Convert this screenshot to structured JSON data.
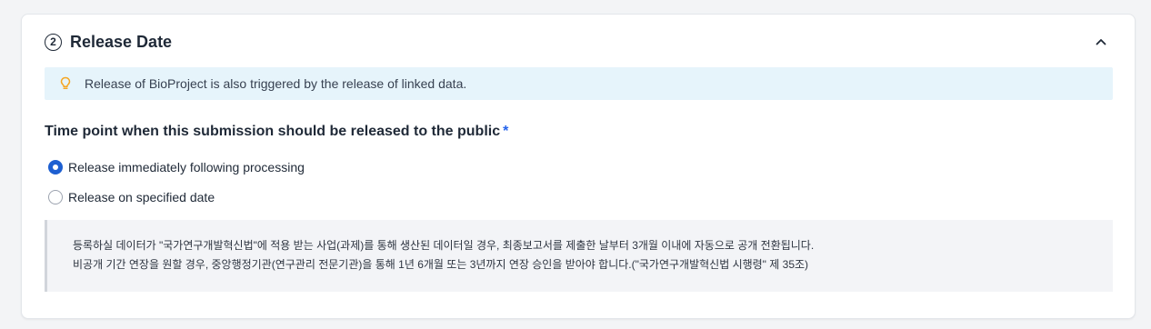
{
  "section": {
    "step_number": "2",
    "title": "Release Date",
    "collapse_icon": "chevron-up-icon"
  },
  "info": {
    "icon": "lightbulb-icon",
    "text": "Release of BioProject is also triggered by the release of linked data."
  },
  "question": {
    "label": "Time point when this submission should be released to the public",
    "required_marker": "*"
  },
  "options": [
    {
      "label": "Release immediately following processing",
      "checked": true
    },
    {
      "label": "Release on specified date",
      "checked": false
    }
  ],
  "notice": {
    "lines": [
      "등록하실 데이터가 \"국가연구개발혁신법\"에 적용 받는 사업(과제)를 통해 생산된 데이터일 경우, 최종보고서를 제출한 날부터 3개월 이내에 자동으로 공개 전환됩니다.",
      "비공개 기간 연장을 원할 경우, 중앙행정기관(연구관리 전문기관)을 통해 1년 6개월 또는 3년까지 연장 승인을 받아야 합니다.(\"국가연구개발혁신법 시행령\" 제 35조)"
    ]
  },
  "colors": {
    "accent": "#1d5fd1",
    "info_bg": "#e6f4fb",
    "bulb": "#f5a623",
    "required": "#2563eb"
  }
}
